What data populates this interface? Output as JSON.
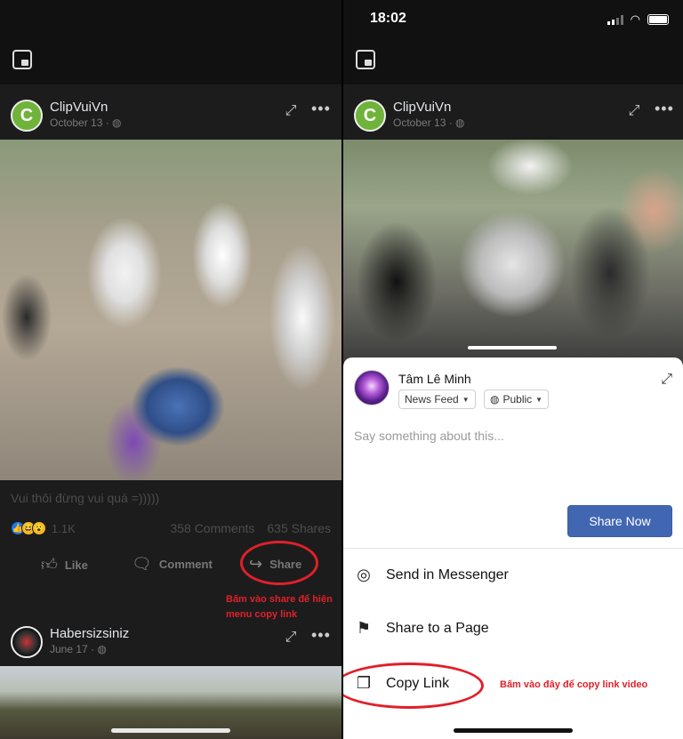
{
  "status": {
    "time": "18:02"
  },
  "post": {
    "page_name": "ClipVuiVn",
    "date": "October 13 ·",
    "privacy_icon": "globe-icon",
    "caption": "Vui thôi đừng vui quá =)))))",
    "reaction_count": "1.1K",
    "comments": "358 Comments",
    "shares": "635 Shares",
    "actions": {
      "like": "Like",
      "comment": "Comment",
      "share": "Share"
    }
  },
  "next_post": {
    "page_name": "Habersizsiniz",
    "date": "June 17 ·"
  },
  "annotations": {
    "left": "Bấm vào share để hiện menu copy link",
    "right": "Bấm vào đây để copy link video",
    "color": "#e0202a"
  },
  "share_sheet": {
    "user_name": "Tâm Lê Minh",
    "audience": "News Feed",
    "privacy": "Public",
    "placeholder": "Say something about this...",
    "share_now": "Share Now",
    "options": [
      "Send in Messenger",
      "Share to a Page",
      "Copy Link"
    ]
  },
  "colors": {
    "accent": "#4267b2",
    "dark_bg": "#1c1c1c"
  }
}
